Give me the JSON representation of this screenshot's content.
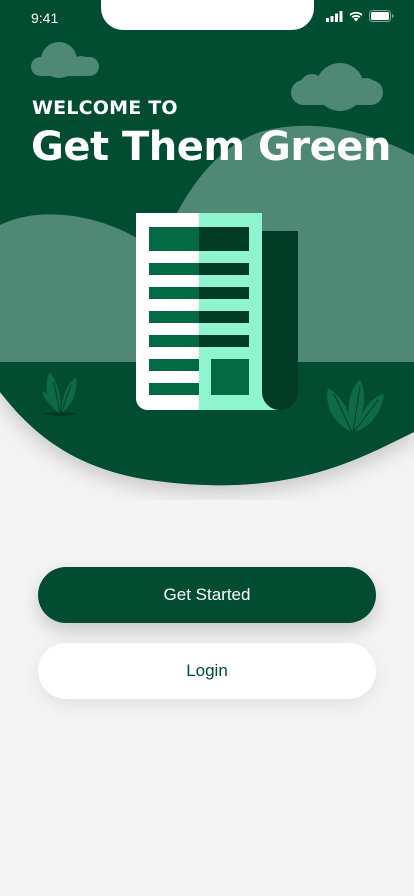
{
  "status_bar": {
    "time": "9:41",
    "icons": [
      "signal-icon",
      "wifi-icon",
      "battery-icon"
    ]
  },
  "hero": {
    "welcome_label": "WELCOME TO",
    "app_title": "Get Them Green",
    "illustration": "document-icon",
    "decorations": [
      "cloud-icon",
      "cloud-icon",
      "plant-icon",
      "plant-icon"
    ]
  },
  "actions": {
    "get_started_label": "Get Started",
    "login_label": "Login"
  },
  "colors": {
    "brand_dark": "#024d31",
    "brand_mid": "#046a44",
    "accent_mint": "#8ff5cf",
    "background": "#f4f4f4"
  }
}
